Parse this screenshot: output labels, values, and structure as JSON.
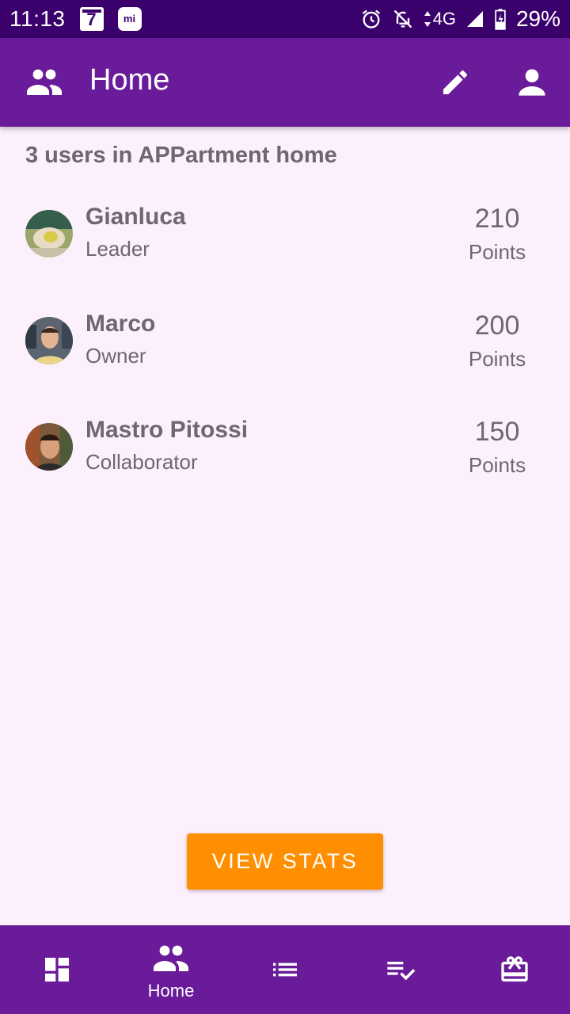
{
  "status_bar": {
    "time": "11:13",
    "calendar_day": "7",
    "mi_label": "mi",
    "network": "4G",
    "battery": "29%"
  },
  "app_bar": {
    "title": "Home",
    "icons": [
      "group-icon",
      "edit-icon",
      "person-icon"
    ]
  },
  "main": {
    "heading": "3 users in APPartment home",
    "users": [
      {
        "name": "Gianluca",
        "role": "Leader",
        "points": "210",
        "points_label": "Points"
      },
      {
        "name": "Marco",
        "role": "Owner",
        "points": "200",
        "points_label": "Points"
      },
      {
        "name": "Mastro Pitossi",
        "role": "Collaborator",
        "points": "150",
        "points_label": "Points"
      }
    ],
    "view_stats_label": "VIEW STATS"
  },
  "bottom_nav": {
    "items": [
      {
        "icon": "dashboard-icon",
        "label": ""
      },
      {
        "icon": "group-icon",
        "label": "Home"
      },
      {
        "icon": "list-icon",
        "label": ""
      },
      {
        "icon": "playlist-check-icon",
        "label": ""
      },
      {
        "icon": "gift-card-icon",
        "label": ""
      }
    ],
    "active_index": 1
  },
  "colors": {
    "status_bar": "#3A006B",
    "primary": "#6A1B9A",
    "accent": "#FF8F00",
    "background": "#FDF0FD",
    "text": "#6E6670"
  }
}
